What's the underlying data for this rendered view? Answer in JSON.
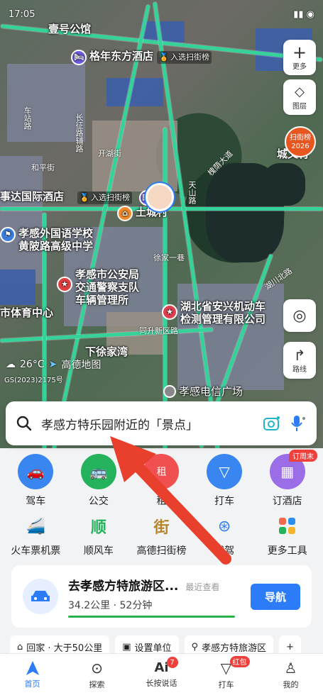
{
  "status": {
    "time": "17:05"
  },
  "map": {
    "pois": [
      {
        "label": "壹号公馆"
      },
      {
        "label": "格年东方酒店",
        "rank": "入选扫街榜"
      },
      {
        "label": "事达国际酒店",
        "rank": "入选扫街榜"
      },
      {
        "label": "土城村"
      },
      {
        "label": "孝感外国语学校",
        "sub": "黄陂路高级中学"
      },
      {
        "label": "孝感市公安局",
        "sub": "交通警察支队",
        "sub2": "车辆管理所"
      },
      {
        "label": "湖北省安兴机动车",
        "sub": "检测管理有限公司"
      },
      {
        "label": "市体育中心"
      },
      {
        "label": "下徐家湾"
      },
      {
        "label": "孝感电信广场"
      },
      {
        "label": "城文村"
      }
    ],
    "roads": [
      "天山路",
      "同升新区路",
      "徐家一巷",
      "长征路辅路",
      "槐荫大道",
      "湖川北路",
      "车站路",
      "和平街",
      "开湖街"
    ],
    "weather": "26°C",
    "brand": "高德地图",
    "copyright": "GS(2023)2175号"
  },
  "map_buttons": {
    "more": "更多",
    "layers": "图层",
    "rank_title": "扫街榜",
    "rank_year": "2026",
    "route": "路线"
  },
  "search": {
    "text": "孝感方特乐园附近的「景点」"
  },
  "services": [
    {
      "label": "驾车",
      "color": "#3a86f0"
    },
    {
      "label": "公交",
      "color": "#24b35c"
    },
    {
      "label": "租",
      "color": "#f05050"
    },
    {
      "label": "打车",
      "color": "#3a86f0"
    },
    {
      "label": "订酒店",
      "color": "#9b6ee8",
      "tag": "订周末"
    },
    {
      "label": "火车票机票"
    },
    {
      "label": "顺风车"
    },
    {
      "label": "高德扫街榜"
    },
    {
      "label": "代驾"
    },
    {
      "label": "更多工具"
    }
  ],
  "recent": {
    "title": "去孝感方特旅游区...",
    "recent_label": "最近查看",
    "distance": "34.2公里 · 52分钟",
    "button": "导航"
  },
  "shortcuts": [
    {
      "label": "回家 · 大于50公里"
    },
    {
      "label": "设置单位"
    },
    {
      "label": "孝感方特旅游区"
    }
  ],
  "tabs": [
    {
      "label": "首页"
    },
    {
      "label": "探索"
    },
    {
      "label": "长按说话",
      "badge": "7"
    },
    {
      "label": "打车",
      "badge": "红包"
    },
    {
      "label": "我的"
    }
  ]
}
